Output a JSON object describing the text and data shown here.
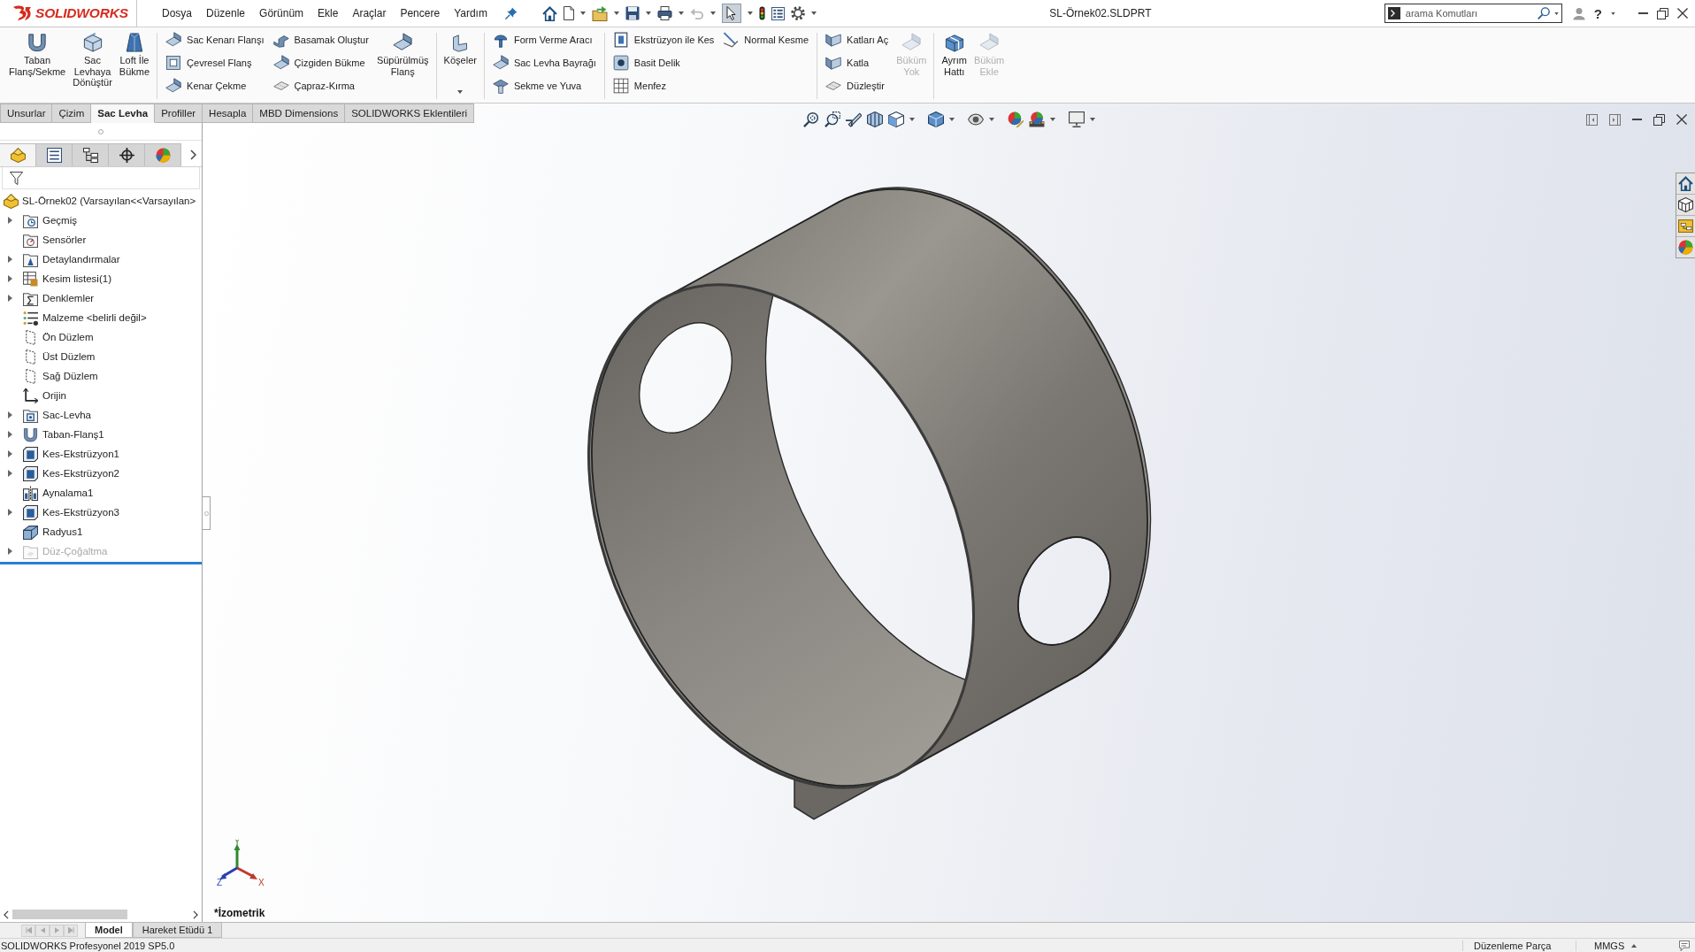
{
  "app": {
    "logo": "SOLIDWORKS"
  },
  "menu": [
    "Dosya",
    "Düzenle",
    "Görünüm",
    "Ekle",
    "Araçlar",
    "Pencere",
    "Yardım"
  ],
  "select_tool": {
    "active": true
  },
  "window": {
    "title": "SL-Örnek02.SLDPRT"
  },
  "search": {
    "placeholder": "arama Komutları"
  },
  "help": "?",
  "ribbon": [
    {
      "items": [
        {
          "kind": "large",
          "label": "Taban\nFlanş/Sekme",
          "disabled": false
        },
        {
          "kind": "large",
          "label": "Sac\nLevhaya\nDönüştür",
          "disabled": false
        },
        {
          "kind": "large",
          "label": "Loft İle\nBükme",
          "disabled": false
        }
      ]
    },
    {
      "items": [
        {
          "kind": "column",
          "buttons": [
            {
              "label": "Sac Kenarı Flanşı",
              "disabled": false
            },
            {
              "label": "Çevresel Flanş",
              "disabled": false
            },
            {
              "label": "Kenar Çekme",
              "disabled": false
            }
          ]
        },
        {
          "kind": "column",
          "buttons": [
            {
              "label": "Basamak Oluştur",
              "disabled": false
            },
            {
              "label": "Çizgiden Bükme",
              "disabled": false
            },
            {
              "label": "Çapraz-Kırma",
              "disabled": false
            }
          ]
        },
        {
          "kind": "large",
          "label": "Süpürülmüş\nFlanş",
          "disabled": false
        }
      ]
    },
    {
      "items": [
        {
          "kind": "split",
          "label": "Köşeler",
          "disabled": false
        }
      ]
    },
    {
      "items": [
        {
          "kind": "column",
          "buttons": [
            {
              "label": "Form Verme Aracı",
              "disabled": false
            },
            {
              "label": "Sac Levha Bayrağı",
              "disabled": false
            },
            {
              "label": "Sekme ve Yuva",
              "disabled": false
            }
          ]
        }
      ]
    },
    {
      "items": [
        {
          "kind": "column",
          "buttons": [
            {
              "label": "Ekstrüzyon ile Kes",
              "disabled": false
            },
            {
              "label": "Basit Delik",
              "disabled": false
            },
            {
              "label": "Menfez",
              "disabled": false
            }
          ]
        },
        {
          "kind": "column",
          "buttons": [
            {
              "label": "Normal Kesme",
              "disabled": false
            }
          ]
        }
      ]
    },
    {
      "items": [
        {
          "kind": "column",
          "buttons": [
            {
              "label": "Katları Aç",
              "disabled": false
            },
            {
              "label": "Katla",
              "disabled": false
            },
            {
              "label": "Düzleştir",
              "disabled": false
            }
          ]
        },
        {
          "kind": "large",
          "label": "Büküm\nYok",
          "disabled": true
        }
      ]
    },
    {
      "items": [
        {
          "kind": "large",
          "label": "Ayrım\nHattı",
          "disabled": false
        },
        {
          "kind": "large",
          "label": "Büküm\nEkle",
          "disabled": true
        }
      ]
    }
  ],
  "command_tabs": [
    {
      "label": "Unsurlar",
      "selected": false
    },
    {
      "label": "Çizim",
      "selected": false
    },
    {
      "label": "Sac Levha",
      "selected": true
    },
    {
      "label": "Profiller",
      "selected": false
    },
    {
      "label": "Hesapla",
      "selected": false
    },
    {
      "label": "MBD Dimensions",
      "selected": false
    },
    {
      "label": "SOLIDWORKS Eklentileri",
      "selected": false
    }
  ],
  "panel_tabs": [
    {
      "selected": true
    },
    {
      "selected": false
    },
    {
      "selected": false
    },
    {
      "selected": false
    },
    {
      "selected": false
    }
  ],
  "feature_tree": {
    "label": "SL-Örnek02 (Varsayılan<<Varsayılan>",
    "children": [
      {
        "label": "Geçmiş",
        "kind": "history",
        "expandable": true,
        "disabled": false
      },
      {
        "label": "Sensörler",
        "kind": "sensors",
        "expandable": false,
        "disabled": false
      },
      {
        "label": "Detaylandırmalar",
        "kind": "annotations",
        "expandable": true,
        "disabled": false
      },
      {
        "label": "Kesim listesi(1)",
        "kind": "cutlist",
        "expandable": true,
        "disabled": false
      },
      {
        "label": "Denklemler",
        "kind": "equations",
        "expandable": true,
        "disabled": false
      },
      {
        "label": "Malzeme <belirli değil>",
        "kind": "material",
        "expandable": false,
        "disabled": false
      },
      {
        "label": "Ön Düzlem",
        "kind": "plane",
        "expandable": false,
        "disabled": false
      },
      {
        "label": "Üst Düzlem",
        "kind": "plane",
        "expandable": false,
        "disabled": false
      },
      {
        "label": "Sağ Düzlem",
        "kind": "plane",
        "expandable": false,
        "disabled": false
      },
      {
        "label": "Orijin",
        "kind": "origin",
        "expandable": false,
        "disabled": false
      },
      {
        "label": "Sac-Levha",
        "kind": "sheetmetal",
        "expandable": true,
        "disabled": false
      },
      {
        "label": "Taban-Flanş1",
        "kind": "flange",
        "expandable": true,
        "disabled": false
      },
      {
        "label": "Kes-Ekstrüzyon1",
        "kind": "cut",
        "expandable": true,
        "disabled": false
      },
      {
        "label": "Kes-Ekstrüzyon2",
        "kind": "cut",
        "expandable": true,
        "disabled": false
      },
      {
        "label": "Aynalama1",
        "kind": "mirror",
        "expandable": false,
        "disabled": false
      },
      {
        "label": "Kes-Ekstrüzyon3",
        "kind": "cut",
        "expandable": true,
        "disabled": false
      },
      {
        "label": "Radyus1",
        "kind": "fillet",
        "expandable": false,
        "disabled": false
      },
      {
        "label": "Düz-Çoğaltma",
        "kind": "flatpattern",
        "expandable": true,
        "disabled": true
      }
    ]
  },
  "viewport": {
    "triad_labels": [
      "Y",
      "Z",
      "X"
    ],
    "view_name": "*İzometrik"
  },
  "bottom_tabs": [
    {
      "label": "Model",
      "selected": true
    },
    {
      "label": "Hareket Etüdü 1",
      "selected": false
    }
  ],
  "status_bar": {
    "product": "SOLIDWORKS Profesyonel 2019 SP5.0",
    "mode": "Düzenleme Parça",
    "units": "MMGS"
  }
}
